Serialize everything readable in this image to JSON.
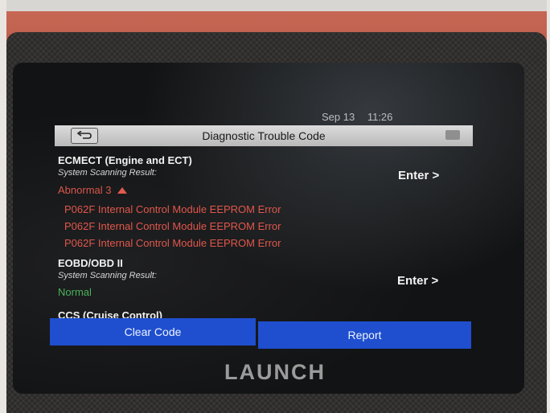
{
  "status": {
    "date": "Sep 13",
    "time": "11:26"
  },
  "header": {
    "title": "Diagnostic Trouble Code"
  },
  "systems": [
    {
      "name": "ECMECT (Engine and ECT)",
      "result_label": "System Scanning Result:",
      "result": "Abnormal 3",
      "action": "Enter >",
      "codes": [
        "P062F Internal Control Module EEPROM Error",
        "P062F Internal Control Module EEPROM Error",
        "P062F Internal Control Module EEPROM Error"
      ]
    },
    {
      "name": "EOBD/OBD II",
      "result_label": "System Scanning Result:",
      "result": "Normal",
      "action": "Enter >"
    },
    {
      "name": "CCS (Cruise Control)"
    }
  ],
  "footer": {
    "clear_label": "Clear Code",
    "report_label": "Report"
  },
  "brand": {
    "logo": "LAUNCH"
  },
  "colors": {
    "abnormal": "#d8564a",
    "normal": "#48b15a",
    "button": "#1f4fcf"
  },
  "icons": {
    "back": "back-arrow-icon",
    "warning": "warning-triangle-icon"
  }
}
